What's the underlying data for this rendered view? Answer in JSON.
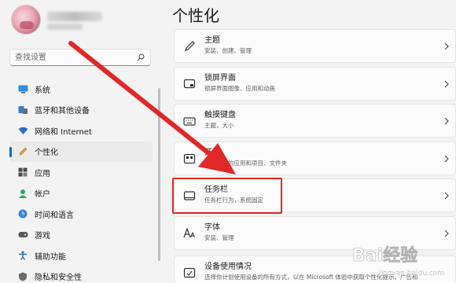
{
  "sidebar": {
    "search_placeholder": "查找设置",
    "items": [
      {
        "label": "系统",
        "icon": "monitor-icon"
      },
      {
        "label": "蓝牙和其他设备",
        "icon": "bluetooth-icon"
      },
      {
        "label": "网络和 Internet",
        "icon": "wifi-icon"
      },
      {
        "label": "个性化",
        "icon": "pencil-icon",
        "selected": true
      },
      {
        "label": "应用",
        "icon": "apps-icon"
      },
      {
        "label": "帐户",
        "icon": "account-icon"
      },
      {
        "label": "时间和语言",
        "icon": "globe-clock-icon"
      },
      {
        "label": "游戏",
        "icon": "gamepad-icon"
      },
      {
        "label": "辅助功能",
        "icon": "accessibility-icon"
      },
      {
        "label": "隐私和安全性",
        "icon": "shield-icon"
      }
    ]
  },
  "main": {
    "title": "个性化",
    "cards": [
      {
        "title": "主题",
        "subtitle": "安装、创建、管理",
        "icon": "brush-icon"
      },
      {
        "title": "锁屏界面",
        "subtitle": "锁屏界面图像、应用和动画",
        "icon": "lockscreen-icon"
      },
      {
        "title": "触摸键盘",
        "subtitle": "主题，大小",
        "icon": "keyboard-icon"
      },
      {
        "title": "开始",
        "subtitle": "最近使用的应用和项目、文件夹",
        "icon": "start-icon"
      },
      {
        "title": "任务栏",
        "subtitle": "任务栏行为，系统固定",
        "icon": "taskbar-icon"
      },
      {
        "title": "字体",
        "subtitle": "安装、管理",
        "icon": "font-icon"
      },
      {
        "title": "设备使用情况",
        "subtitle": "选择你计划使用设备的所有方式，以在 Microsoft 体验中获取个性化提示、广告和",
        "icon": "device-usage-icon"
      }
    ]
  },
  "colors": {
    "accent": "#0067c0",
    "annotation_red": "#e02828"
  },
  "watermark": {
    "text": "Bai经验",
    "sub": "jingyan.baidu.com"
  }
}
